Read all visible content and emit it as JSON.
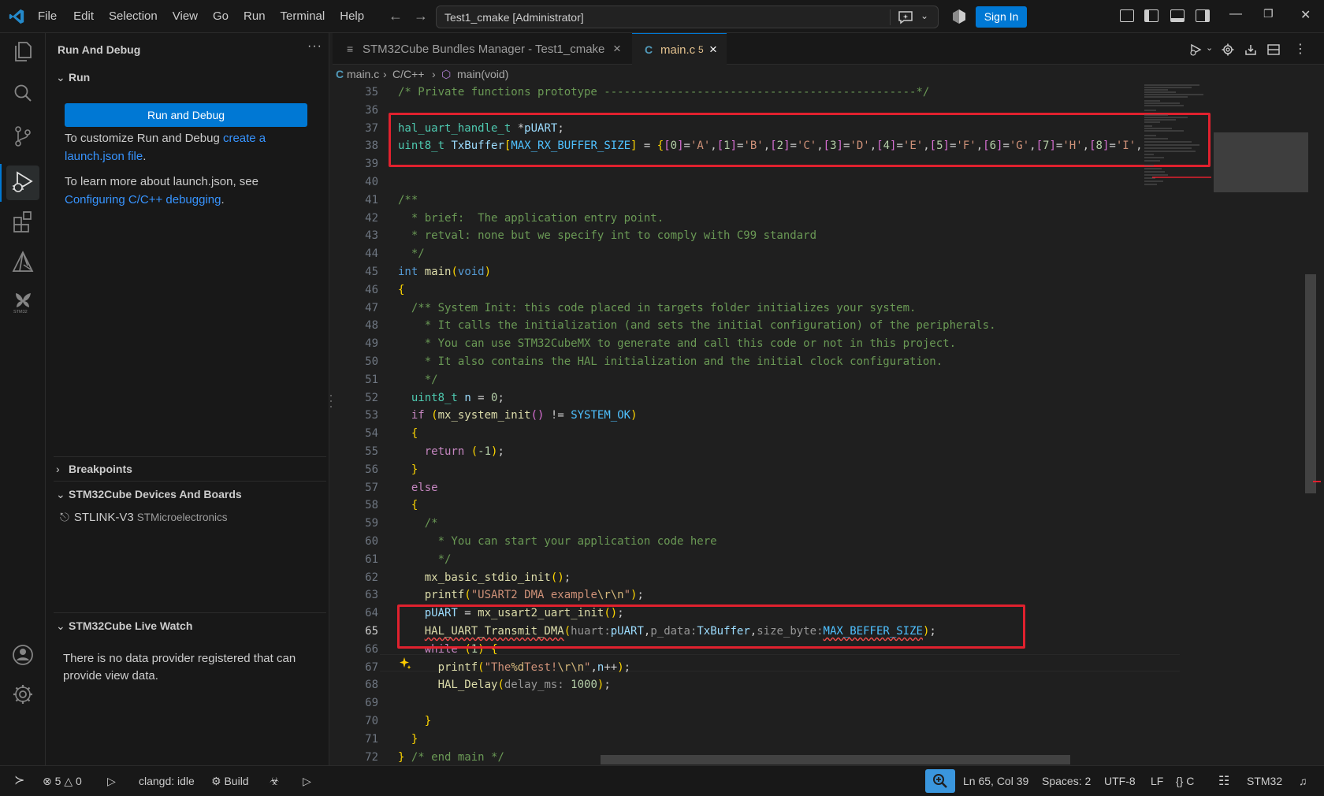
{
  "titlebar": {
    "menu": [
      "File",
      "Edit",
      "Selection",
      "View",
      "Go",
      "Run",
      "Terminal",
      "Help"
    ],
    "search_text": "Test1_cmake [Administrator]",
    "sign_in": "Sign In"
  },
  "sidebar": {
    "title": "Run And Debug",
    "more": "···",
    "run_section": "Run",
    "run_button": "Run and Debug",
    "customize_pre": "To customize Run and Debug ",
    "customize_link": "create a launch.json file",
    "customize_post": ".",
    "learn_pre": "To learn more about launch.json, see ",
    "learn_link": "Configuring C/C++ debugging",
    "learn_post": ".",
    "breakpoints": "Breakpoints",
    "devices_section": "STM32Cube Devices And Boards",
    "device_name": "STLINK-V3",
    "device_vendor": "STMicroelectronics",
    "livewatch_section": "STM32Cube Live Watch",
    "livewatch_text": "There is no data provider registered that can provide view data."
  },
  "tabs": {
    "tab1_label": "STM32Cube Bundles Manager - Test1_cmake",
    "tab2_label": "main.c",
    "tab2_badge": "5",
    "tab2_icon": "C"
  },
  "breadcrumb": {
    "file": "main.c",
    "lang": "C/C++",
    "symbol": "main(void)"
  },
  "editor": {
    "line_numbers": [
      "35",
      "36",
      "37",
      "38",
      "39",
      "40",
      "41",
      "42",
      "43",
      "44",
      "45",
      "46",
      "47",
      "48",
      "49",
      "50",
      "51",
      "52",
      "53",
      "54",
      "55",
      "56",
      "57",
      "58",
      "59",
      "60",
      "61",
      "62",
      "63",
      "64",
      "65",
      "66",
      "67",
      "68",
      "69",
      "70",
      "71",
      "72"
    ],
    "code_lines": [
      "/* Private functions prototype -----------------------------------------------*/",
      "",
      "hal_uart_handle_t *pUART;",
      "uint8_t TxBuffer[MAX_RX_BUFFER_SIZE] = {[0]='A',[1]='B',[2]='C',[3]='D',[4]='E',[5]='F',[6]='G',[7]='H',[8]='I',",
      "",
      "",
      "/**",
      "  * brief:  The application entry point.",
      "  * retval: none but we specify int to comply with C99 standard",
      "  */",
      "int main(void)",
      "{",
      "  /** System Init: this code placed in targets folder initializes your system.",
      "    * It calls the initialization (and sets the initial configuration) of the peripherals.",
      "    * You can use STM32CubeMX to generate and call this code or not in this project.",
      "    * It also contains the HAL initialization and the initial clock configuration.",
      "    */",
      "  uint8_t n = 0;",
      "  if (mx_system_init() != SYSTEM_OK)",
      "  {",
      "    return (-1);",
      "  }",
      "  else",
      "  {",
      "    /*",
      "      * You can start your application code here",
      "      */",
      "    mx_basic_stdio_init();",
      "    printf(\"USART2 DMA example\\r\\n\");",
      "    pUART = mx_usart2_uart_init();",
      "    HAL_UART_Transmit_DMA(huart:pUART,p_data:TxBuffer,size_byte:MAX_BEFFER_SIZE);",
      "    while (1) {",
      "      printf(\"The%dTest!\\r\\n\",n++);",
      "      HAL_Delay(delay_ms: 1000);",
      "",
      "    }",
      "  }",
      "} /* end main */"
    ]
  },
  "statusbar": {
    "errors": "5",
    "warnings": "0",
    "clangd": "clangd: idle",
    "build": "Build",
    "position": "Ln 65, Col 39",
    "spaces": "Spaces: 2",
    "encoding": "UTF-8",
    "eol": "LF",
    "language": "C",
    "stm32": "STM32"
  },
  "colors": {
    "accent": "#0078d4",
    "highlight_box": "#e0212e",
    "link": "#3794ff"
  }
}
